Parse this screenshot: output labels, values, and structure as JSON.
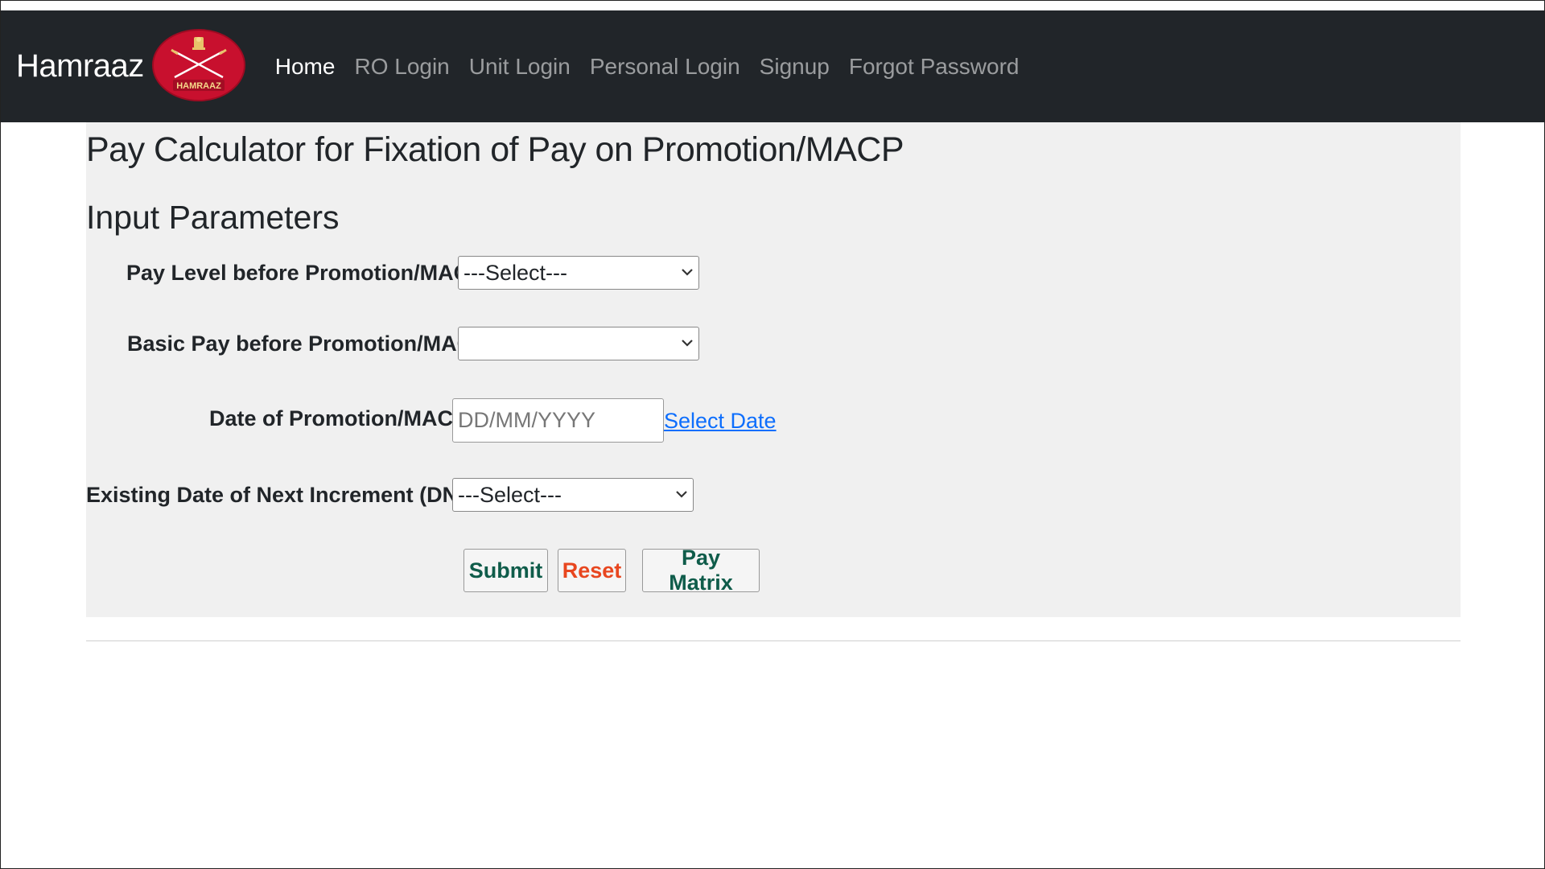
{
  "navbar": {
    "brand": "Hamraaz",
    "logo_text": "HAMRAAZ",
    "links": [
      {
        "label": "Home",
        "active": true
      },
      {
        "label": "RO Login",
        "active": false
      },
      {
        "label": "Unit Login",
        "active": false
      },
      {
        "label": "Personal Login",
        "active": false
      },
      {
        "label": "Signup",
        "active": false
      },
      {
        "label": "Forgot Password",
        "active": false
      }
    ]
  },
  "main": {
    "title": "Pay Calculator for Fixation of Pay on Promotion/MACP",
    "section_title": "Input Parameters",
    "fields": {
      "pay_level": {
        "label": "Pay Level before Promotion/MACP :",
        "value": "---Select---"
      },
      "basic_pay": {
        "label": "Basic Pay before Promotion/MACP :",
        "value": ""
      },
      "promotion_date": {
        "label": "Date of Promotion/MACP :",
        "placeholder": "DD/MM/YYYY",
        "link": "Select Date"
      },
      "dni": {
        "label": "Existing Date of Next Increment (DNI) :",
        "value": "---Select---"
      }
    },
    "buttons": {
      "submit": "Submit",
      "reset": "Reset",
      "pay_matrix": "Pay Matrix"
    }
  },
  "colors": {
    "navbar_bg": "#212529",
    "content_bg": "#f0f0f0",
    "link": "#0d6efd",
    "submit_text": "#0f5c4a",
    "reset_text": "#e8461f"
  }
}
